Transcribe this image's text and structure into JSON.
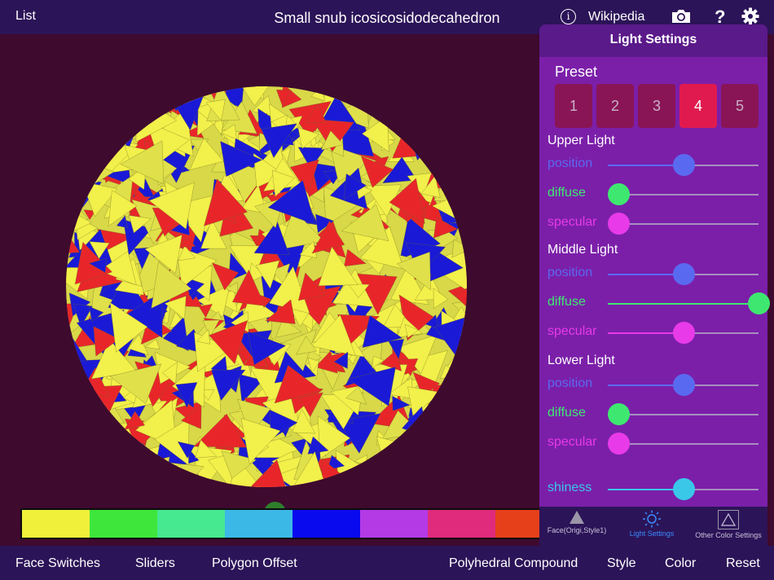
{
  "topbar": {
    "list_label": "List",
    "title": "Small snub icosicosidodecahedron",
    "info_glyph": "i",
    "wikipedia_label": "Wikipedia",
    "help_glyph": "?"
  },
  "colors": {
    "background": "#3e0a2e",
    "bar": "#2c1458",
    "panel": "#7b1fa9",
    "accent_active_tab": "#3a8cff",
    "preset_active": "#e01a4f"
  },
  "polyhedron_colors": [
    "#f2f04a",
    "#e8262a",
    "#1a1ad6",
    "#e0e04a"
  ],
  "main_slider": {
    "value": 0.5
  },
  "color_swatches": [
    "#f0f03a",
    "#3ee63c",
    "#46e890",
    "#3cb8e6",
    "#0a0aee",
    "#b43ae6",
    "#e02a7c",
    "#e6401a"
  ],
  "light_panel": {
    "title": "Light Settings",
    "preset_label": "Preset",
    "presets": [
      "1",
      "2",
      "3",
      "4",
      "5"
    ],
    "active_preset": "4",
    "sections": [
      {
        "title": "Upper Light",
        "rows": [
          {
            "label": "position",
            "value": 0.5,
            "color": "#5a6af0"
          },
          {
            "label": "diffuse",
            "value": 0.0,
            "color": "#3ee870"
          },
          {
            "label": "specular",
            "value": 0.0,
            "color": "#e83ae8"
          }
        ]
      },
      {
        "title": "Middle Light",
        "rows": [
          {
            "label": "position",
            "value": 0.5,
            "color": "#5a6af0"
          },
          {
            "label": "diffuse",
            "value": 1.0,
            "color": "#3ee870"
          },
          {
            "label": "specular",
            "value": 0.5,
            "color": "#e83ae8"
          }
        ]
      },
      {
        "title": "Lower Light",
        "rows": [
          {
            "label": "position",
            "value": 0.5,
            "color": "#5a6af0"
          },
          {
            "label": "diffuse",
            "value": 0.0,
            "color": "#3ee870"
          },
          {
            "label": "specular",
            "value": 0.0,
            "color": "#e83ae8"
          }
        ]
      }
    ],
    "shiness": {
      "label": "shiness",
      "value": 0.5,
      "color": "#3ac8e8"
    }
  },
  "panel_tabs": [
    {
      "label": "Face(Origi,Style1)",
      "icon": "triangle-filled-icon"
    },
    {
      "label": "Light Settings",
      "icon": "sun-icon",
      "active": true
    },
    {
      "label": "Other Color Settings",
      "icon": "triangle-outline-icon"
    }
  ],
  "bottombar": {
    "face_switches": "Face Switches",
    "sliders": "Sliders",
    "polygon_offset": "Polygon Offset",
    "polyhedral_compound": "Polyhedral Compound",
    "style": "Style",
    "color": "Color",
    "reset": "Reset"
  }
}
